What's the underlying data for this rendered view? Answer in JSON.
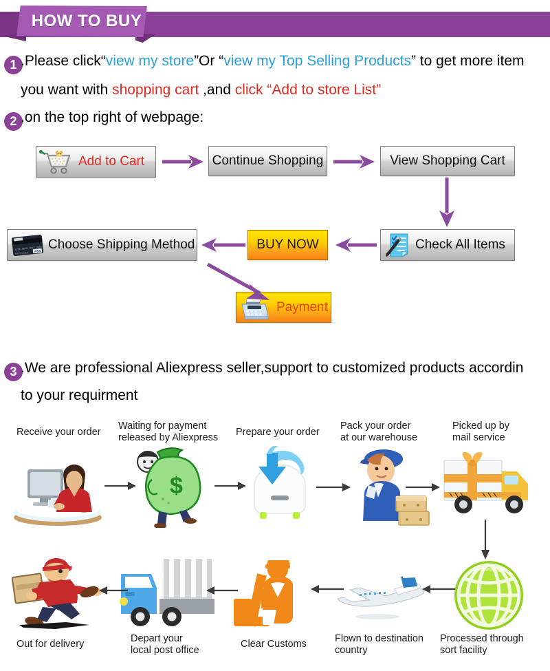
{
  "header": {
    "title": "HOW TO BUY",
    "ribbon_color": "#a45ab3",
    "ribbon_bar_color": "#8c4199",
    "ribbon_fold_color": "#6f2f7b"
  },
  "steps": {
    "one": {
      "number": "1",
      "prefix": ".Please click“",
      "link1": "view my store",
      "mid": "”Or “",
      "link2": "view my Top Selling Products",
      "suffix": "” to get more item",
      "line2_pre": "you want with ",
      "line2_red1": "shopping cart",
      "line2_mid": " ,and ",
      "line2_red2": "click “Add to store List”"
    },
    "two": {
      "number": "2",
      "text": ".on the top right of webpage:"
    },
    "three": {
      "number": "3",
      "text": ".We are professional Aliexpress seller,support to customized products accordin",
      "line2": "to your requirment"
    }
  },
  "flow_buttons": [
    {
      "id": "add-to-cart",
      "label": "Add to Cart",
      "icon": "shopping-cart-icon",
      "style": "gray-red-text"
    },
    {
      "id": "continue-shopping",
      "label": "Continue Shopping",
      "icon": "none",
      "style": "gray"
    },
    {
      "id": "view-cart",
      "label": "View Shopping Cart",
      "icon": "none",
      "style": "gray"
    },
    {
      "id": "check-items",
      "label": "Check All Items",
      "icon": "checklist-icon",
      "style": "gray"
    },
    {
      "id": "buy-now",
      "label": "BUY NOW",
      "icon": "none",
      "style": "orange"
    },
    {
      "id": "choose-shipping",
      "label": "Choose Shipping Method",
      "icon": "credit-card-icon",
      "style": "gray"
    },
    {
      "id": "payment",
      "label": "Payment",
      "icon": "cash-register-icon",
      "style": "orange-red-text"
    }
  ],
  "arrow_color": "#8a4a9e",
  "process": {
    "row1": [
      {
        "label": "Receive your order",
        "icon": "person-at-computer-icon"
      },
      {
        "label": "Waiting for payment\nreleased by Aliexpress",
        "icon": "money-bag-icon"
      },
      {
        "label": "Prepare your order",
        "icon": "download-box-icon"
      },
      {
        "label": "Pack your order\nat our warehouse",
        "icon": "worker-packing-icon"
      },
      {
        "label": "Picked up by\nmail service",
        "icon": "delivery-truck-gift-icon"
      }
    ],
    "row2": [
      {
        "label": "Out for delivery",
        "icon": "running-courier-icon"
      },
      {
        "label": "Depart your\nlocal post office",
        "icon": "blue-truck-icon"
      },
      {
        "label": "Clear Customs",
        "icon": "customs-officer-icon"
      },
      {
        "label": "Flown to destination\ncountry",
        "icon": "airplane-icon"
      },
      {
        "label": "Processed through\nsort facility",
        "icon": "green-globe-icon"
      }
    ]
  }
}
